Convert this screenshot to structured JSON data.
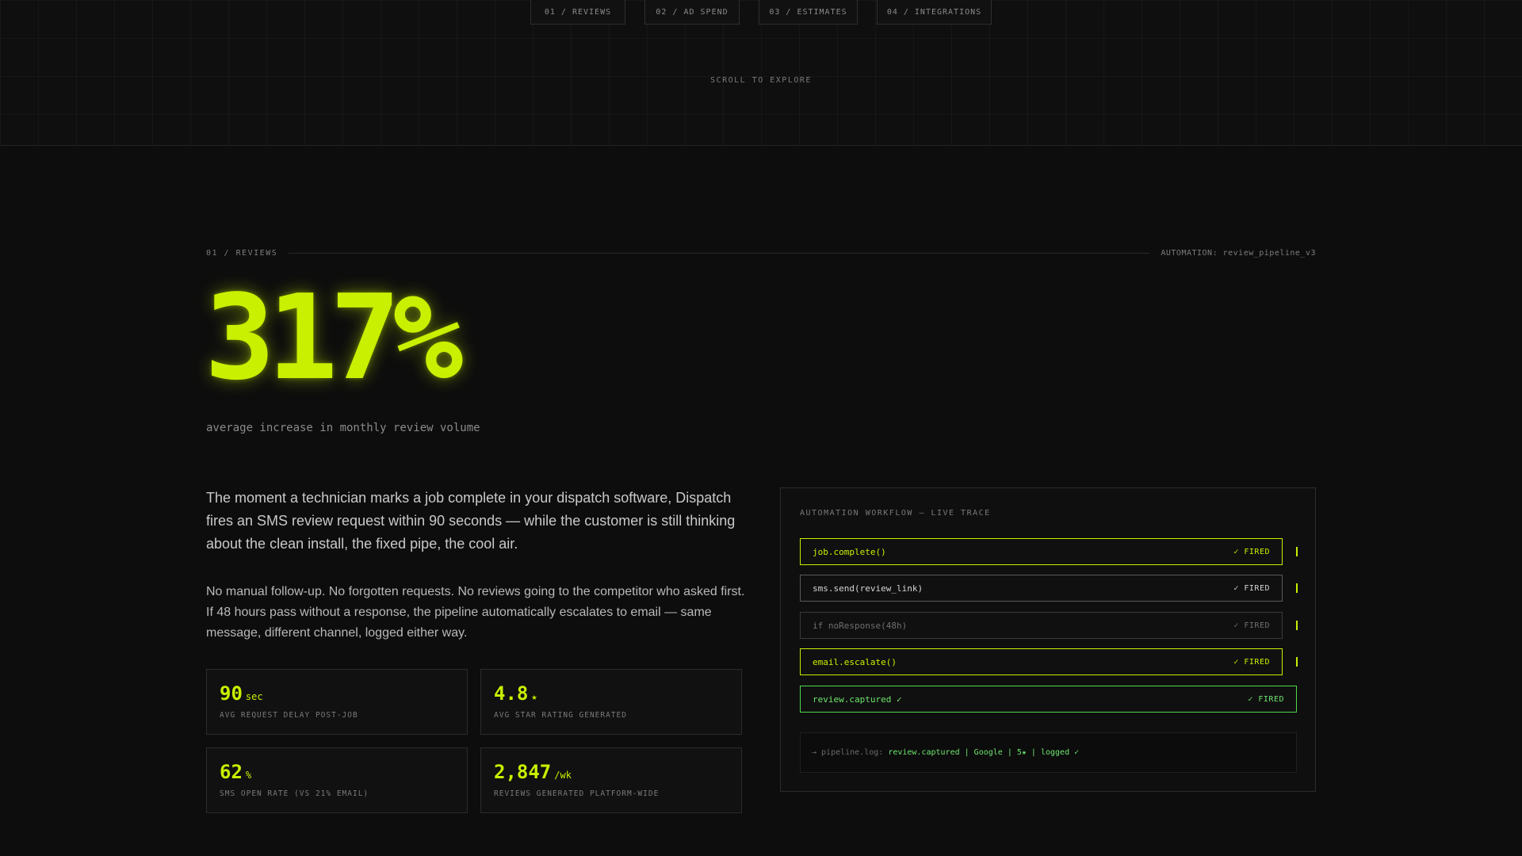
{
  "nav": {
    "tabs": [
      {
        "label": "01 / REVIEWS"
      },
      {
        "label": "02 / AD SPEND"
      },
      {
        "label": "03 / ESTIMATES"
      },
      {
        "label": "04 / INTEGRATIONS"
      }
    ],
    "scroll_hint": "SCROLL TO EXPLORE"
  },
  "section": {
    "label": "01 / REVIEWS",
    "meta": "AUTOMATION: review_pipeline_v3",
    "big_stat": "317%",
    "big_caption": "average increase in monthly review volume",
    "para1": "The moment a technician marks a job complete in your dispatch software, Dispatch fires an SMS review request within 90 seconds — while the customer is still thinking about the clean install, the fixed pipe, the cool air.",
    "para2": "No manual follow-up. No forgotten requests. No reviews going to the competitor who asked first. If 48 hours pass without a response, the pipeline automatically escalates to email — same message, different channel, logged either way."
  },
  "metrics": [
    {
      "value": "90",
      "unit": "sec",
      "label": "AVG REQUEST DELAY POST-JOB"
    },
    {
      "value": "4.8",
      "unit": "★",
      "label": "AVG STAR RATING GENERATED"
    },
    {
      "value": "62",
      "unit": "%",
      "label": "SMS OPEN RATE (VS 21% EMAIL)"
    },
    {
      "value": "2,847",
      "unit": "/wk",
      "label": "REVIEWS GENERATED PLATFORM-WIDE"
    }
  ],
  "workflow": {
    "title": "AUTOMATION WORKFLOW — LIVE TRACE",
    "steps": [
      {
        "name": "job.complete()",
        "status": "✓ FIRED",
        "state": "active"
      },
      {
        "name": "sms.send(review_link)",
        "status": "✓ FIRED",
        "state": "normal"
      },
      {
        "name": "if noResponse(48h)",
        "status": "✓ FIRED",
        "state": "dim"
      },
      {
        "name": "email.escalate()",
        "status": "✓ FIRED",
        "state": "active"
      },
      {
        "name": "review.captured ✓",
        "status": "✓ FIRED",
        "state": "done"
      }
    ],
    "log_prefix": "→ pipeline.log:",
    "log_text": "review.captured | Google | 5★ | logged ✓"
  },
  "colors": {
    "accent": "#c8f000",
    "success": "#6ee66e",
    "background": "#0d0d0d"
  }
}
